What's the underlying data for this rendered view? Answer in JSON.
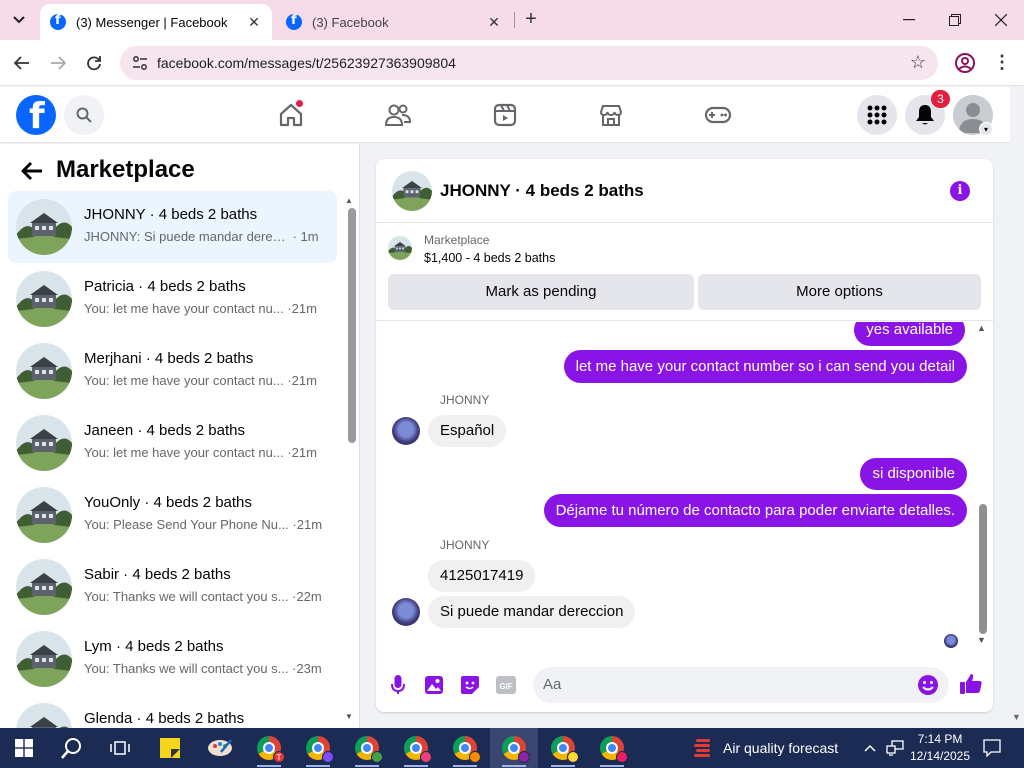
{
  "browser": {
    "tabs": [
      {
        "title": "(3) Messenger | Facebook",
        "active": true
      },
      {
        "title": "(3) Facebook",
        "active": false
      }
    ],
    "url": "facebook.com/messages/t/25623927363909804"
  },
  "fb_header": {
    "notifications_count": "3",
    "nav": [
      "home-icon",
      "friends-icon",
      "video-icon",
      "marketplace-icon",
      "gaming-icon"
    ]
  },
  "left_panel": {
    "title": "Marketplace",
    "conversations": [
      {
        "name": "JHONNY · 4 beds 2 baths",
        "preview": "JHONNY: Si puede mandar derecc...",
        "time": " · 1m",
        "active": true
      },
      {
        "name": "Patricia · 4 beds 2 baths",
        "preview": "You: let me have your contact nu...",
        "time": " ·21m"
      },
      {
        "name": "Merjhani · 4 beds 2 baths",
        "preview": "You: let me have your contact nu...",
        "time": " ·21m"
      },
      {
        "name": "Janeen · 4 beds 2 baths",
        "preview": "You: let me have your contact nu...",
        "time": " ·21m"
      },
      {
        "name": "YouOnly · 4 beds 2 baths",
        "preview": "You: Please Send Your Phone Nu...",
        "time": " ·21m"
      },
      {
        "name": "Sabir · 4 beds 2 baths",
        "preview": "You: Thanks we will contact you s...",
        "time": " ·22m"
      },
      {
        "name": "Lym · 4 beds 2 baths",
        "preview": "You: Thanks we will contact you s...",
        "time": " ·23m"
      },
      {
        "name": "Glenda · 4 beds 2 baths",
        "preview": "",
        "time": ""
      }
    ]
  },
  "chat": {
    "title": "JHONNY · 4 beds 2 baths",
    "marketplace_label": "Marketplace",
    "listing": "$1,400 - 4 beds 2 baths",
    "mark_pending": "Mark as pending",
    "more_options": "More options",
    "messages": [
      {
        "dir": "out",
        "text": "yes available"
      },
      {
        "dir": "out",
        "text": "let me have your contact number so i can send you detail"
      },
      {
        "dir": "label",
        "text": "JHONNY"
      },
      {
        "dir": "in",
        "text": "Español"
      },
      {
        "dir": "out",
        "text": "si disponible"
      },
      {
        "dir": "out",
        "text": "Déjame tu número de contacto para poder enviarte detalles."
      },
      {
        "dir": "label",
        "text": "JHONNY"
      },
      {
        "dir": "in",
        "text": "4125017419"
      },
      {
        "dir": "in",
        "text": "Si puede  mandar  dereccion"
      }
    ],
    "composer_placeholder": "Aa"
  },
  "taskbar": {
    "weather": "Air quality forecast",
    "time": "7:14 PM",
    "date": "12/14/2025"
  },
  "colors": {
    "accent_purple": "#8a14e5",
    "fb_blue": "#0866ff",
    "tab_bar": "#f6dbe9",
    "taskbar": "#1c2b53"
  }
}
